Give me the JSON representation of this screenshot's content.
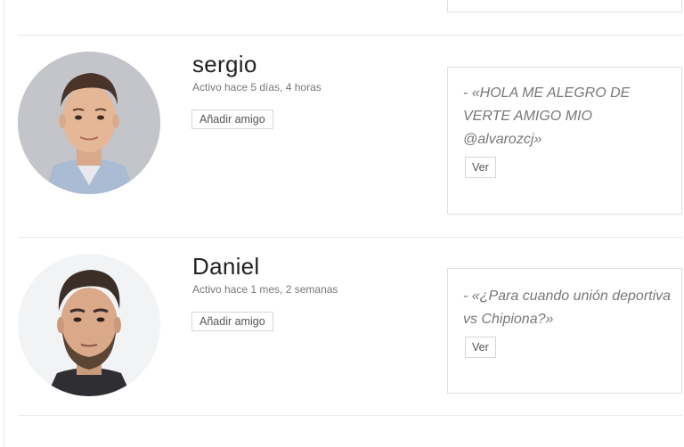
{
  "members": [
    {
      "name": "sergio",
      "activity": "Activo hace 5 días, 4 horas",
      "add_friend_label": "Añadir amigo",
      "update_text": "- «HOLA ME ALEGRO DE VERTE AMIGO MIO @alvarozcj»",
      "view_label": "Ver",
      "avatar_icon": "profile-photo-icon"
    },
    {
      "name": "Daniel",
      "activity": "Activo hace 1 mes, 2 semanas",
      "add_friend_label": "Añadir amigo",
      "update_text": "- «¿Para cuando unión deportiva vs Chipiona?»",
      "view_label": "Ver",
      "avatar_icon": "profile-photo-icon"
    }
  ],
  "colors": {
    "border": "#e0e0e0",
    "muted_text": "#777777",
    "name_text": "#222222"
  }
}
